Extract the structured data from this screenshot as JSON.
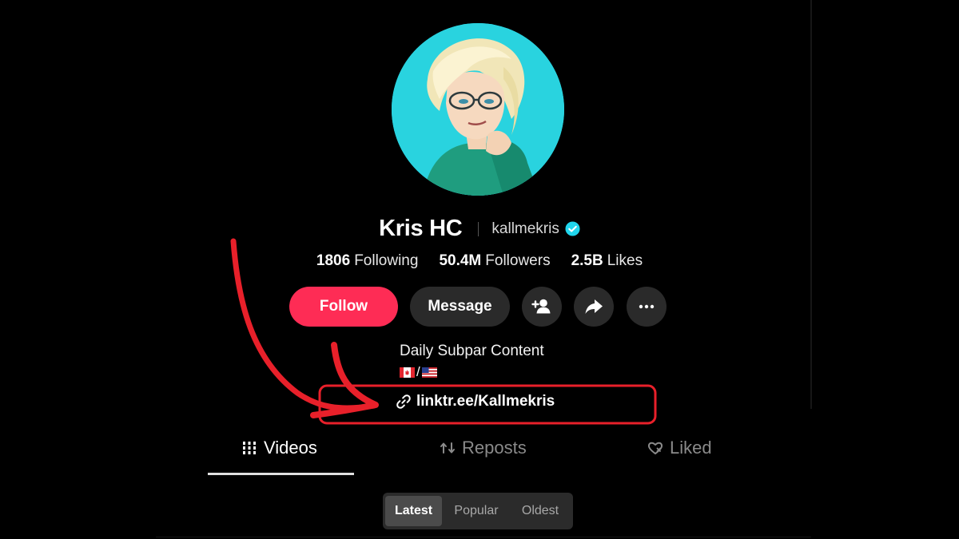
{
  "profile": {
    "display_name": "Kris HC",
    "username": "kallmekris",
    "verified_icon": "verified-badge-icon",
    "avatar_bg": "#29d3df"
  },
  "stats": [
    {
      "value": "1806",
      "label": "Following"
    },
    {
      "value": "50.4M",
      "label": "Followers"
    },
    {
      "value": "2.5B",
      "label": "Likes"
    }
  ],
  "actions": {
    "follow_label": "Follow",
    "message_label": "Message",
    "icons": [
      "add-friend-icon",
      "share-icon",
      "more-icon"
    ]
  },
  "bio": {
    "text": "Daily Subpar Content",
    "flags_sep": "/",
    "link": "linktr.ee/Kallmekris",
    "link_icon": "link-icon"
  },
  "tabs": [
    {
      "label": "Videos",
      "icon": "grid-icon",
      "active": true
    },
    {
      "label": "Reposts",
      "icon": "repost-icon",
      "active": false
    },
    {
      "label": "Liked",
      "icon": "heart-icon",
      "active": false
    }
  ],
  "sort": {
    "options": [
      "Latest",
      "Popular",
      "Oldest"
    ],
    "selected": "Latest"
  },
  "colors": {
    "follow": "#fe2c55",
    "annotation": "#e8202a",
    "verified": "#20d5ec"
  }
}
